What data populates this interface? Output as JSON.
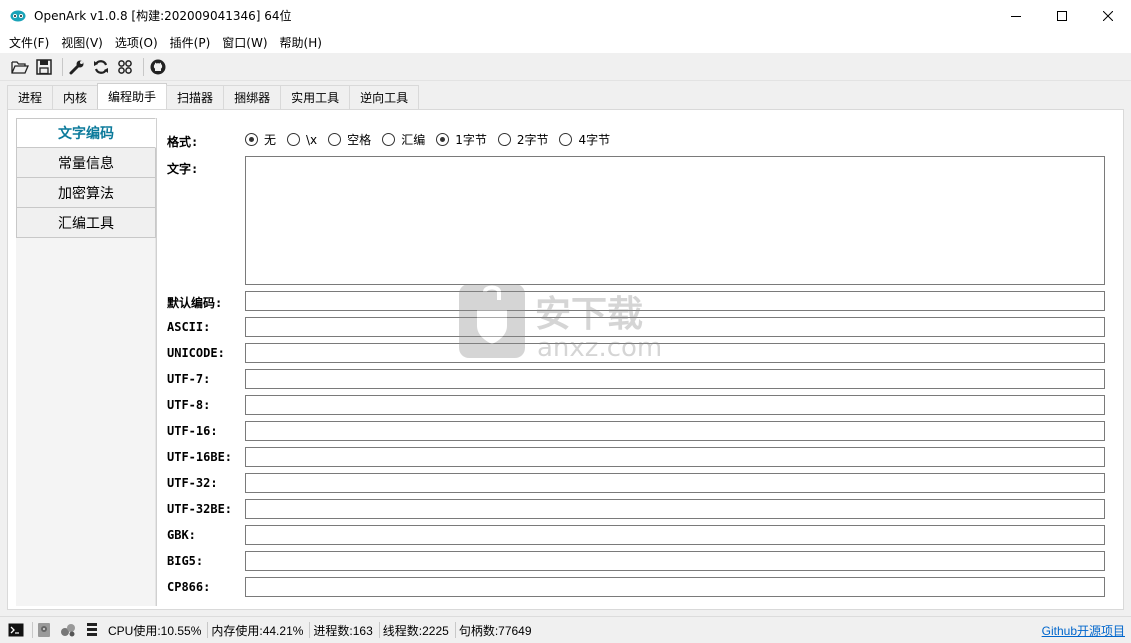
{
  "window": {
    "title": "OpenArk v1.0.8  [构建:202009041346]  64位"
  },
  "menu": [
    "文件(F)",
    "视图(V)",
    "选项(O)",
    "插件(P)",
    "窗口(W)",
    "帮助(H)"
  ],
  "toolbar": {
    "icons": [
      "open-folder-icon",
      "save-icon",
      "wrench-icon",
      "refresh-icon",
      "grid-icon",
      "github-icon"
    ]
  },
  "tabs": [
    {
      "label": "进程",
      "active": false
    },
    {
      "label": "内核",
      "active": false
    },
    {
      "label": "编程助手",
      "active": true
    },
    {
      "label": "扫描器",
      "active": false
    },
    {
      "label": "捆绑器",
      "active": false
    },
    {
      "label": "实用工具",
      "active": false
    },
    {
      "label": "逆向工具",
      "active": false
    }
  ],
  "sidenav": [
    {
      "label": "文字编码",
      "active": true
    },
    {
      "label": "常量信息",
      "active": false
    },
    {
      "label": "加密算法",
      "active": false
    },
    {
      "label": "汇编工具",
      "active": false
    }
  ],
  "form": {
    "format_label": "格式:",
    "text_label": "文字:",
    "text_value": "",
    "radios": [
      {
        "label": "无",
        "checked": true
      },
      {
        "label": "\\x",
        "checked": false
      },
      {
        "label": "空格",
        "checked": false
      },
      {
        "label": "汇编",
        "checked": false
      },
      {
        "label": "1字节",
        "checked": true
      },
      {
        "label": "2字节",
        "checked": false
      },
      {
        "label": "4字节",
        "checked": false
      }
    ],
    "encodings": [
      {
        "label": "默认编码:",
        "value": ""
      },
      {
        "label": "ASCII:",
        "value": ""
      },
      {
        "label": "UNICODE:",
        "value": ""
      },
      {
        "label": "UTF-7:",
        "value": ""
      },
      {
        "label": "UTF-8:",
        "value": ""
      },
      {
        "label": "UTF-16:",
        "value": ""
      },
      {
        "label": "UTF-16BE:",
        "value": ""
      },
      {
        "label": "UTF-32:",
        "value": ""
      },
      {
        "label": "UTF-32BE:",
        "value": ""
      },
      {
        "label": "GBK:",
        "value": ""
      },
      {
        "label": "BIG5:",
        "value": ""
      },
      {
        "label": "CP866:",
        "value": ""
      }
    ]
  },
  "watermark": {
    "text_cn": "安下载",
    "text_en": "anxz.com"
  },
  "status": {
    "cpu": "CPU使用:10.55%",
    "mem": "内存使用:44.21%",
    "proc": "进程数:163",
    "threads": "线程数:2225",
    "handles": "句柄数:77649",
    "link": "Github开源项目"
  }
}
